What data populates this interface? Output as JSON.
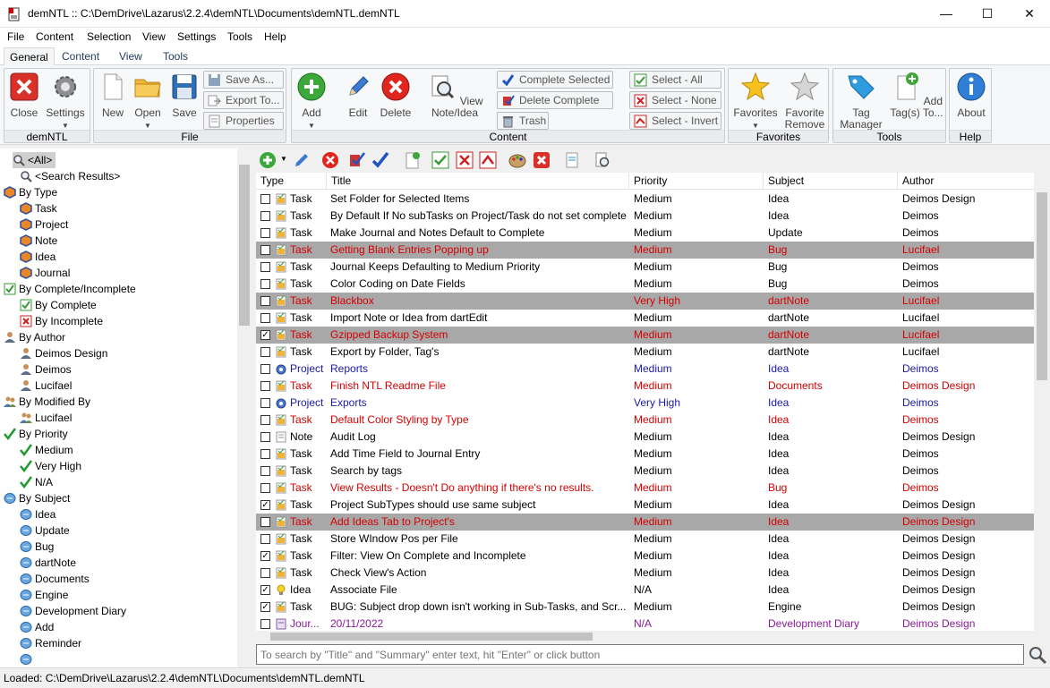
{
  "window": {
    "title": "demNTL :: C:\\DemDrive\\Lazarus\\2.2.4\\demNTL\\Documents\\demNTL.demNTL"
  },
  "menu": [
    "File",
    "Content",
    "Selection",
    "View",
    "Settings",
    "Tools",
    "Help"
  ],
  "tabs": [
    "General",
    "Content",
    "View",
    "Tools"
  ],
  "ribbon": {
    "groups": [
      "demNTL",
      "File",
      "Content",
      "Favorites",
      "Tools",
      "Help"
    ],
    "close": "Close",
    "settings": "Settings",
    "new": "New",
    "open": "Open",
    "save": "Save",
    "save_as": "Save As...",
    "export_to": "Export To...",
    "properties": "Properties",
    "add": "Add",
    "edit": "Edit",
    "delete": "Delete",
    "view_note": "View Note/Idea",
    "complete_selected": "Complete Selected",
    "delete_complete": "Delete Complete",
    "trash": "Trash",
    "select_all": "Select - All",
    "select_none": "Select - None",
    "select_invert": "Select - Invert",
    "favorites": "Favorites",
    "favorite_remove": "Favorite Remove",
    "tag_manager": "Tag Manager",
    "add_tags": "Add Tag(s) To...",
    "about": "About"
  },
  "tree": [
    {
      "label": "<All>",
      "indent": 0,
      "icon": "magnifier",
      "selected": true
    },
    {
      "label": "<Search Results>",
      "indent": 1,
      "icon": "magnifier"
    },
    {
      "label": "By Type",
      "indent": 0,
      "icon": "type"
    },
    {
      "label": "Task",
      "indent": 1,
      "icon": "type"
    },
    {
      "label": "Project",
      "indent": 1,
      "icon": "type"
    },
    {
      "label": "Note",
      "indent": 1,
      "icon": "type"
    },
    {
      "label": "Idea",
      "indent": 1,
      "icon": "type"
    },
    {
      "label": "Journal",
      "indent": 1,
      "icon": "type"
    },
    {
      "label": "By Complete/Incomplete",
      "indent": 0,
      "icon": "check-box"
    },
    {
      "label": "By Complete",
      "indent": 1,
      "icon": "check-box"
    },
    {
      "label": "By Incomplete",
      "indent": 1,
      "icon": "x-box"
    },
    {
      "label": "By Author",
      "indent": 0,
      "icon": "person"
    },
    {
      "label": "Deimos Design",
      "indent": 1,
      "icon": "person"
    },
    {
      "label": "Deimos",
      "indent": 1,
      "icon": "person"
    },
    {
      "label": "Lucifael",
      "indent": 1,
      "icon": "person"
    },
    {
      "label": "By Modified By",
      "indent": 0,
      "icon": "people"
    },
    {
      "label": "Lucifael",
      "indent": 1,
      "icon": "people"
    },
    {
      "label": "By Priority",
      "indent": 0,
      "icon": "checkmark"
    },
    {
      "label": "Medium",
      "indent": 1,
      "icon": "checkmark"
    },
    {
      "label": "Very High",
      "indent": 1,
      "icon": "checkmark"
    },
    {
      "label": "N/A",
      "indent": 1,
      "icon": "checkmark"
    },
    {
      "label": "By Subject",
      "indent": 0,
      "icon": "bubble"
    },
    {
      "label": "Idea",
      "indent": 1,
      "icon": "bubble"
    },
    {
      "label": "Update",
      "indent": 1,
      "icon": "bubble"
    },
    {
      "label": "Bug",
      "indent": 1,
      "icon": "bubble"
    },
    {
      "label": "dartNote",
      "indent": 1,
      "icon": "bubble"
    },
    {
      "label": "Documents",
      "indent": 1,
      "icon": "bubble"
    },
    {
      "label": "Engine",
      "indent": 1,
      "icon": "bubble"
    },
    {
      "label": "Development Diary",
      "indent": 1,
      "icon": "bubble"
    },
    {
      "label": "Add",
      "indent": 1,
      "icon": "bubble"
    },
    {
      "label": "Reminder",
      "indent": 1,
      "icon": "bubble"
    },
    {
      "label": "",
      "indent": 1,
      "icon": "bubble"
    }
  ],
  "grid": {
    "columns": [
      "Type",
      "Title",
      "Priority",
      "Subject",
      "Author"
    ],
    "rows": [
      {
        "checked": false,
        "type": "Task",
        "title": "Set Folder for Selected Items",
        "priority": "Medium",
        "subject": "Idea",
        "author": "Deimos Design",
        "color": "black",
        "hl": false
      },
      {
        "checked": false,
        "type": "Task",
        "title": "By Default If No subTasks on Project/Task do not set complete",
        "priority": "Medium",
        "subject": "Idea",
        "author": "Deimos",
        "color": "black",
        "hl": false
      },
      {
        "checked": false,
        "type": "Task",
        "title": "Make Journal and Notes Default to Complete",
        "priority": "Medium",
        "subject": "Update",
        "author": "Deimos",
        "color": "black",
        "hl": false
      },
      {
        "checked": false,
        "type": "Task",
        "title": "Getting Blank Entries Popping up",
        "priority": "Medium",
        "subject": "Bug",
        "author": "Lucifael",
        "color": "red",
        "hl": true
      },
      {
        "checked": false,
        "type": "Task",
        "title": "Journal Keeps Defaulting to Medium Priority",
        "priority": "Medium",
        "subject": "Bug",
        "author": "Deimos",
        "color": "black",
        "hl": false
      },
      {
        "checked": false,
        "type": "Task",
        "title": "Color Coding on Date Fields",
        "priority": "Medium",
        "subject": "Bug",
        "author": "Deimos",
        "color": "black",
        "hl": false
      },
      {
        "checked": false,
        "type": "Task",
        "title": "Blackbox",
        "priority": "Very High",
        "subject": "dartNote",
        "author": "Lucifael",
        "color": "red",
        "hl": true
      },
      {
        "checked": false,
        "type": "Task",
        "title": "Import Note or Idea from dartEdit",
        "priority": "Medium",
        "subject": "dartNote",
        "author": "Lucifael",
        "color": "black",
        "hl": false
      },
      {
        "checked": true,
        "type": "Task",
        "title": "Gzipped Backup System",
        "priority": "Medium",
        "subject": "dartNote",
        "author": "Lucifael",
        "color": "red",
        "hl": true
      },
      {
        "checked": false,
        "type": "Task",
        "title": "Export by Folder, Tag's",
        "priority": "Medium",
        "subject": "dartNote",
        "author": "Lucifael",
        "color": "black",
        "hl": false
      },
      {
        "checked": false,
        "type": "Project",
        "title": "Reports",
        "priority": "Medium",
        "subject": "Idea",
        "author": "Deimos",
        "color": "blue",
        "hl": false
      },
      {
        "checked": false,
        "type": "Task",
        "title": "Finish NTL Readme File",
        "priority": "Medium",
        "subject": "Documents",
        "author": "Deimos Design",
        "color": "red",
        "hl": false
      },
      {
        "checked": false,
        "type": "Project",
        "title": "Exports",
        "priority": "Very High",
        "subject": "Idea",
        "author": "Deimos",
        "color": "blue",
        "hl": false
      },
      {
        "checked": false,
        "type": "Task",
        "title": "Default Color Styling by Type",
        "priority": "Medium",
        "subject": "Idea",
        "author": "Deimos",
        "color": "red",
        "hl": false
      },
      {
        "checked": false,
        "type": "Note",
        "title": "Audit Log",
        "priority": "Medium",
        "subject": "Idea",
        "author": "Deimos Design",
        "color": "black",
        "hl": false
      },
      {
        "checked": false,
        "type": "Task",
        "title": "Add Time Field to Journal Entry",
        "priority": "Medium",
        "subject": "Idea",
        "author": "Deimos",
        "color": "black",
        "hl": false
      },
      {
        "checked": false,
        "type": "Task",
        "title": "Search by tags",
        "priority": "Medium",
        "subject": "Idea",
        "author": "Deimos",
        "color": "black",
        "hl": false
      },
      {
        "checked": false,
        "type": "Task",
        "title": "View Results - Doesn't Do anything if there's no results.",
        "priority": "Medium",
        "subject": "Bug",
        "author": "Deimos",
        "color": "red",
        "hl": false
      },
      {
        "checked": true,
        "type": "Task",
        "title": "Project SubTypes should use same subject",
        "priority": "Medium",
        "subject": "Idea",
        "author": "Deimos Design",
        "color": "black",
        "hl": false
      },
      {
        "checked": false,
        "type": "Task",
        "title": "Add Ideas Tab to Project's",
        "priority": "Medium",
        "subject": "Idea",
        "author": "Deimos Design",
        "color": "red",
        "hl": true
      },
      {
        "checked": false,
        "type": "Task",
        "title": "Store WIndow Pos per File",
        "priority": "Medium",
        "subject": "Idea",
        "author": "Deimos Design",
        "color": "black",
        "hl": false
      },
      {
        "checked": true,
        "type": "Task",
        "title": "Filter: View On Complete and Incomplete",
        "priority": "Medium",
        "subject": "Idea",
        "author": "Deimos Design",
        "color": "black",
        "hl": false
      },
      {
        "checked": false,
        "type": "Task",
        "title": "Check View's Action",
        "priority": "Medium",
        "subject": "Idea",
        "author": "Deimos Design",
        "color": "black",
        "hl": false
      },
      {
        "checked": true,
        "type": "Idea",
        "title": "Associate File",
        "priority": "N/A",
        "subject": "Idea",
        "author": "Deimos Design",
        "color": "black",
        "hl": false
      },
      {
        "checked": true,
        "type": "Task",
        "title": "BUG: Subject drop down isn't working in Sub-Tasks, and Scr...",
        "priority": "Medium",
        "subject": "Engine",
        "author": "Deimos Design",
        "color": "black",
        "hl": false
      },
      {
        "checked": false,
        "type": "Jour...",
        "title": "20/11/2022",
        "priority": "N/A",
        "subject": "Development Diary",
        "author": "Deimos Design",
        "color": "purple",
        "hl": false
      }
    ]
  },
  "search": {
    "placeholder": "To search by \"Title\" and \"Summary\" enter text, hit \"Enter\" or click button"
  },
  "status": {
    "text": "Loaded: C:\\DemDrive\\Lazarus\\2.2.4\\demNTL\\Documents\\demNTL.demNTL"
  },
  "colors": {
    "red": "#d40000",
    "blue": "#1a1aa8",
    "purple": "#8b1a9a",
    "black": "#000000",
    "accent": "#2b6cb8"
  }
}
